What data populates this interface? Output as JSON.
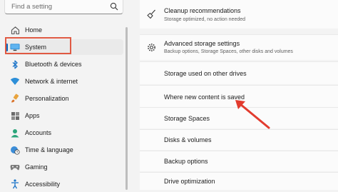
{
  "search": {
    "placeholder": "Find a setting"
  },
  "sidebar": {
    "items": [
      {
        "label": "Home",
        "icon": "home-icon"
      },
      {
        "label": "System",
        "icon": "display-icon"
      },
      {
        "label": "Bluetooth & devices",
        "icon": "bluetooth-icon"
      },
      {
        "label": "Network & internet",
        "icon": "wifi-icon"
      },
      {
        "label": "Personalization",
        "icon": "brush-icon"
      },
      {
        "label": "Apps",
        "icon": "apps-icon"
      },
      {
        "label": "Accounts",
        "icon": "person-icon"
      },
      {
        "label": "Time & language",
        "icon": "globe-clock-icon"
      },
      {
        "label": "Gaming",
        "icon": "controller-icon"
      },
      {
        "label": "Accessibility",
        "icon": "accessibility-icon"
      }
    ],
    "active_index": 1
  },
  "main": {
    "cleanup": {
      "title": "Cleanup recommendations",
      "subtitle": "Storage optimized, no action needed",
      "icon": "broom-icon"
    },
    "advanced": {
      "title": "Advanced storage settings",
      "subtitle": "Backup options, Storage Spaces, other disks and volumes",
      "icon": "gear-icon"
    },
    "options": [
      "Storage used on other drives",
      "Where new content is saved",
      "Storage Spaces",
      "Disks & volumes",
      "Backup options",
      "Drive optimization"
    ]
  },
  "colors": {
    "highlight_border": "#e05a43",
    "arrow": "#e23b2e",
    "accent": "#0067c0"
  }
}
